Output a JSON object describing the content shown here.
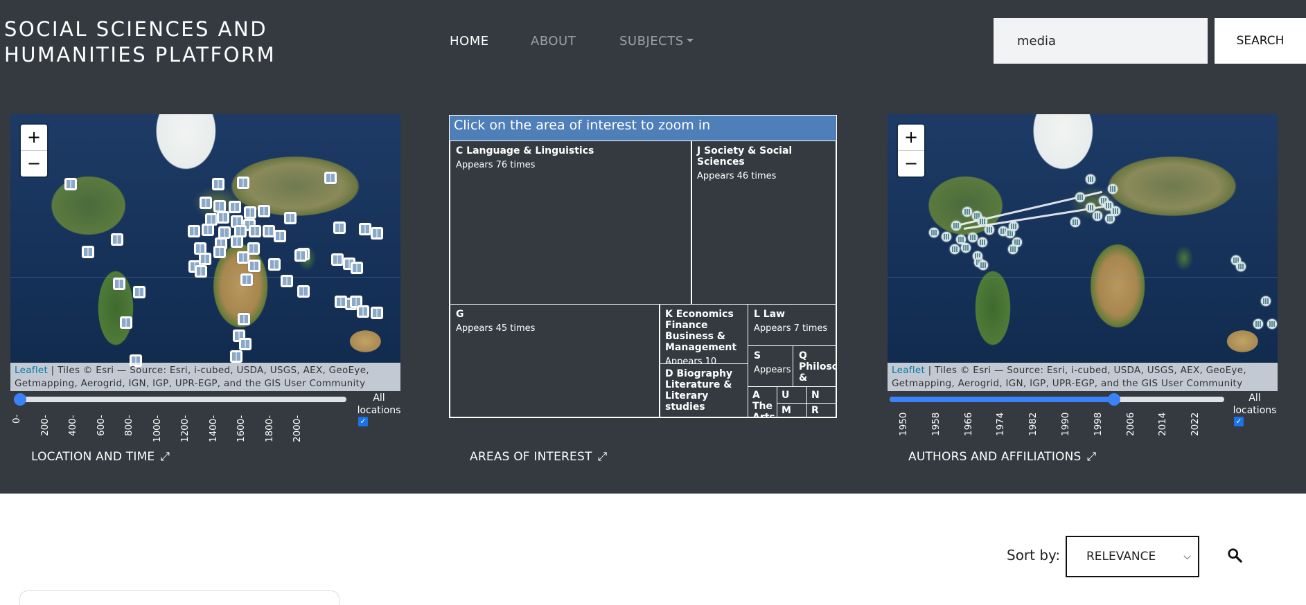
{
  "header": {
    "brand_line1": "SOCIAL SCIENCES AND",
    "brand_line2": "HUMANITIES PLATFORM",
    "nav": {
      "home": "HOME",
      "about": "ABOUT",
      "subjects": "SUBJECTS"
    },
    "search": {
      "value": "media",
      "button": "SEARCH"
    }
  },
  "location_panel": {
    "zoom_in": "+",
    "zoom_out": "−",
    "attribution_link": "Leaflet",
    "attribution_text": " | Tiles © Esri — Source: Esri, i-cubed, USDA, USGS, AEX, GeoEye, Getmapping, Aerogrid, IGN, IGP, UPR-EGP, and the GIS User Community",
    "slider_ticks": [
      "0-",
      "200-",
      "400-",
      "600-",
      "800-",
      "1000-",
      "1200-",
      "1400-",
      "1600-",
      "1800-",
      "2000-"
    ],
    "slider_value_fraction": 0.0,
    "all_locations_label": "All locations",
    "all_locations_checked": true,
    "label": "LOCATION AND TIME"
  },
  "areas_panel": {
    "header": "Click on the area of interest to zoom in",
    "cells": {
      "c": {
        "title": "C Language & Linguistics",
        "sub": "Appears 76 times"
      },
      "j": {
        "title": "J Society & Social Sciences",
        "sub": "Appears 46 times"
      },
      "g": {
        "title": "G",
        "sub": "Appears 45 times"
      },
      "k": {
        "title": "K Economics Finance Business & Management",
        "sub": "Appears 10"
      },
      "l": {
        "title": "L Law",
        "sub": "Appears 7 times"
      },
      "d": {
        "title": "D Biography Literature & Literary studies",
        "sub": ""
      },
      "s": {
        "title": "S",
        "sub": "Appears"
      },
      "q": {
        "title": "Q Philoso &",
        "sub": ""
      },
      "a": {
        "title": "A The Arts",
        "sub": ""
      },
      "u": {
        "title": "U",
        "sub": ""
      },
      "n": {
        "title": "N",
        "sub": ""
      },
      "m": {
        "title": "M",
        "sub": ""
      },
      "r": {
        "title": "R",
        "sub": ""
      }
    },
    "label": "AREAS OF INTEREST"
  },
  "authors_panel": {
    "zoom_in": "+",
    "zoom_out": "−",
    "attribution_link": "Leaflet",
    "attribution_text": " | Tiles © Esri — Source: Esri, i-cubed, USDA, USGS, AEX, GeoEye, Getmapping, Aerogrid, IGN, IGP, UPR-EGP, and the GIS User Community",
    "slider_ticks": [
      "1950",
      "1958",
      "1966",
      "1974",
      "1982",
      "1990",
      "1998",
      "2006",
      "2014",
      "2022"
    ],
    "slider_value_fraction": 0.67,
    "all_locations_label": "All locations",
    "all_locations_checked": true,
    "label": "AUTHORS AND AFFILIATIONS"
  },
  "results": {
    "sort_label": "Sort by:",
    "sort_value": "RELEVANCE"
  },
  "colors": {
    "hero_bg": "#343a40",
    "treemap_header": "#4f7fb8",
    "accent": "#3b82f6"
  },
  "icons": [
    "book-marker-icon",
    "institution-marker-icon",
    "expand-icon",
    "chevron-down-icon",
    "search-icon"
  ]
}
